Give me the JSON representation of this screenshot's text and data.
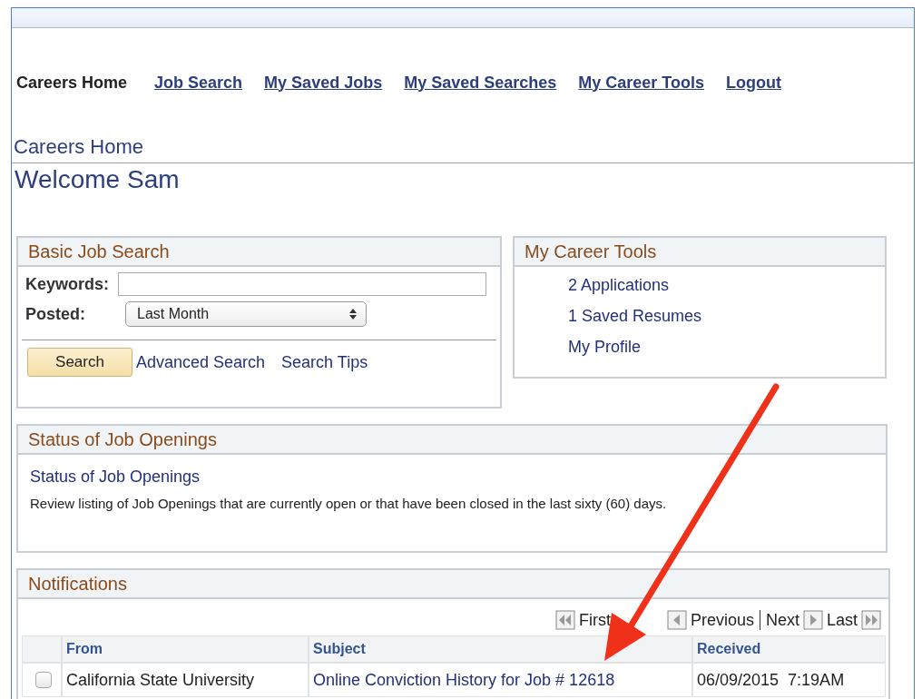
{
  "nav": [
    {
      "label": "Careers Home",
      "selected": true
    },
    {
      "label": "Job Search",
      "selected": false
    },
    {
      "label": "My Saved Jobs",
      "selected": false
    },
    {
      "label": "My Saved Searches",
      "selected": false
    },
    {
      "label": "My Career Tools",
      "selected": false
    },
    {
      "label": "Logout",
      "selected": false
    }
  ],
  "page_title": "Careers Home",
  "welcome": "Welcome Sam",
  "basic_search": {
    "title": "Basic Job Search",
    "keywords_label": "Keywords:",
    "posted_label": "Posted:",
    "posted_value": "Last Month",
    "search_button": "Search",
    "links": [
      "Advanced Search",
      "Search Tips"
    ]
  },
  "career_tools": {
    "title": "My Career Tools",
    "links": [
      "2 Applications",
      "1 Saved Resumes",
      "My Profile"
    ]
  },
  "status": {
    "title": "Status of Job Openings",
    "link": "Status of Job Openings",
    "description": "Review listing of Job Openings that are currently open or that have been closed in the last sixty (60) days."
  },
  "notifications": {
    "title": "Notifications",
    "pager": {
      "first": "First",
      "previous": "Previous",
      "next": "Next",
      "last": "Last"
    },
    "columns": [
      "From",
      "Subject",
      "Received"
    ],
    "rows": [
      {
        "checked": false,
        "from": "California State University",
        "subject": "Online Conviction History for Job # 12618",
        "received": "06/09/2015  7:19AM"
      }
    ]
  }
}
